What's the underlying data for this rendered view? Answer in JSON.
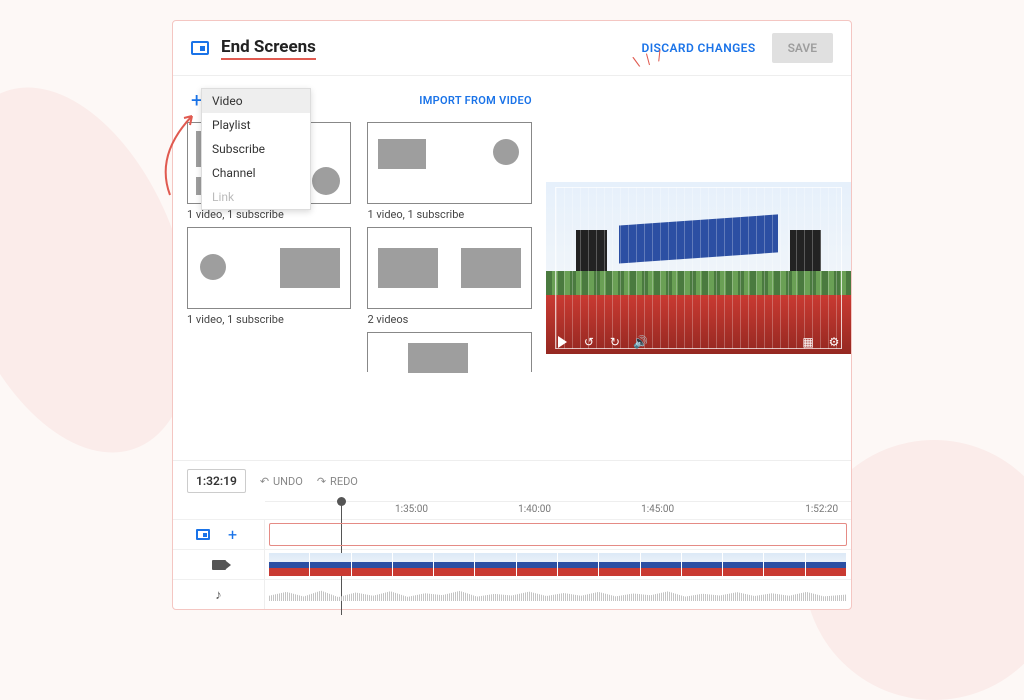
{
  "header": {
    "title": "End Screens",
    "discard_label": "DISCARD CHANGES",
    "save_label": "SAVE"
  },
  "add_menu": {
    "items": [
      "Video",
      "Playlist",
      "Subscribe",
      "Channel",
      "Link"
    ],
    "highlighted": "Video",
    "disabled": [
      "Link"
    ]
  },
  "import_label": "IMPORT FROM VIDEO",
  "templates": [
    {
      "caption": "1 video, 1 subscribe",
      "layout": "rect-tl-circ-br"
    },
    {
      "caption": "1 video, 1 subscribe",
      "layout": "rect-tl-small-circ-tr"
    },
    {
      "caption": "1 video, 1 subscribe",
      "layout": "circ-l-rect-r"
    },
    {
      "caption": "2 videos",
      "layout": "two-rects"
    },
    {
      "caption": "",
      "layout": "rect-center-partial"
    }
  ],
  "timeline": {
    "current_time": "1:32:19",
    "undo_label": "UNDO",
    "redo_label": "REDO",
    "ruler_labels": [
      "1:35:00",
      "1:40:00",
      "1:45:00",
      "1:52:20"
    ],
    "ruler_positions_pct": [
      25,
      46,
      67,
      95
    ],
    "playhead_pct": 13
  },
  "player_icons": [
    "play",
    "rewind",
    "loop",
    "volume",
    "grid",
    "settings"
  ]
}
